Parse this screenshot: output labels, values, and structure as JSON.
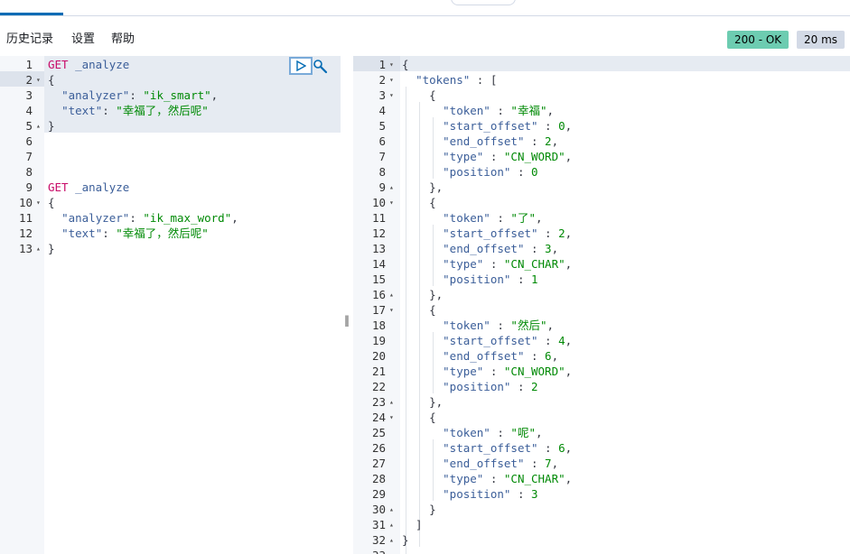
{
  "menu": {
    "history": "历史记录",
    "settings": "设置",
    "help": "帮助"
  },
  "status": {
    "code": "200 - OK",
    "time": "20 ms"
  },
  "request_lines": [
    {
      "n": "1",
      "fold": "",
      "segs": [
        [
          "GET",
          "k-method"
        ],
        [
          " _analyze",
          "k-key"
        ]
      ]
    },
    {
      "n": "2",
      "fold": "▾",
      "segs": [
        [
          "{",
          "k-punc"
        ]
      ]
    },
    {
      "n": "3",
      "fold": "",
      "segs": [
        [
          "  ",
          "k-punc"
        ],
        [
          "\"analyzer\"",
          "k-key"
        ],
        [
          ": ",
          "k-punc"
        ],
        [
          "\"ik_smart\"",
          "k-str"
        ],
        [
          ",",
          "k-punc"
        ]
      ]
    },
    {
      "n": "4",
      "fold": "",
      "segs": [
        [
          "  ",
          "k-punc"
        ],
        [
          "\"text\"",
          "k-key"
        ],
        [
          ": ",
          "k-punc"
        ],
        [
          "\"幸福了，然后呢\"",
          "k-str"
        ]
      ]
    },
    {
      "n": "5",
      "fold": "▴",
      "segs": [
        [
          "}",
          "k-punc"
        ]
      ]
    },
    {
      "n": "6",
      "fold": "",
      "segs": []
    },
    {
      "n": "7",
      "fold": "",
      "segs": []
    },
    {
      "n": "8",
      "fold": "",
      "segs": []
    },
    {
      "n": "9",
      "fold": "",
      "segs": [
        [
          "GET",
          "k-method"
        ],
        [
          " _analyze",
          "k-key"
        ]
      ]
    },
    {
      "n": "10",
      "fold": "▾",
      "segs": [
        [
          "{",
          "k-punc"
        ]
      ]
    },
    {
      "n": "11",
      "fold": "",
      "segs": [
        [
          "  ",
          "k-punc"
        ],
        [
          "\"analyzer\"",
          "k-key"
        ],
        [
          ": ",
          "k-punc"
        ],
        [
          "\"ik_max_word\"",
          "k-str"
        ],
        [
          ",",
          "k-punc"
        ]
      ]
    },
    {
      "n": "12",
      "fold": "",
      "segs": [
        [
          "  ",
          "k-punc"
        ],
        [
          "\"text\"",
          "k-key"
        ],
        [
          ": ",
          "k-punc"
        ],
        [
          "\"幸福了，然后呢\"",
          "k-str"
        ]
      ]
    },
    {
      "n": "13",
      "fold": "▴",
      "segs": [
        [
          "}",
          "k-punc"
        ]
      ]
    }
  ],
  "response_lines": [
    {
      "n": "1",
      "fold": "▾",
      "segs": [
        [
          "{",
          "k-punc"
        ]
      ]
    },
    {
      "n": "2",
      "fold": "▾",
      "segs": [
        [
          "  ",
          "k-punc"
        ],
        [
          "\"tokens\"",
          "k-key"
        ],
        [
          " : [",
          "k-punc"
        ]
      ]
    },
    {
      "n": "3",
      "fold": "▾",
      "segs": [
        [
          "    {",
          "k-punc"
        ]
      ]
    },
    {
      "n": "4",
      "fold": "",
      "segs": [
        [
          "      ",
          "k-punc"
        ],
        [
          "\"token\"",
          "k-key"
        ],
        [
          " : ",
          "k-punc"
        ],
        [
          "\"幸福\"",
          "k-str"
        ],
        [
          ",",
          "k-punc"
        ]
      ]
    },
    {
      "n": "5",
      "fold": "",
      "segs": [
        [
          "      ",
          "k-punc"
        ],
        [
          "\"start_offset\"",
          "k-key"
        ],
        [
          " : ",
          "k-punc"
        ],
        [
          "0",
          "k-num"
        ],
        [
          ",",
          "k-punc"
        ]
      ]
    },
    {
      "n": "6",
      "fold": "",
      "segs": [
        [
          "      ",
          "k-punc"
        ],
        [
          "\"end_offset\"",
          "k-key"
        ],
        [
          " : ",
          "k-punc"
        ],
        [
          "2",
          "k-num"
        ],
        [
          ",",
          "k-punc"
        ]
      ]
    },
    {
      "n": "7",
      "fold": "",
      "segs": [
        [
          "      ",
          "k-punc"
        ],
        [
          "\"type\"",
          "k-key"
        ],
        [
          " : ",
          "k-punc"
        ],
        [
          "\"CN_WORD\"",
          "k-str"
        ],
        [
          ",",
          "k-punc"
        ]
      ]
    },
    {
      "n": "8",
      "fold": "",
      "segs": [
        [
          "      ",
          "k-punc"
        ],
        [
          "\"position\"",
          "k-key"
        ],
        [
          " : ",
          "k-punc"
        ],
        [
          "0",
          "k-num"
        ]
      ]
    },
    {
      "n": "9",
      "fold": "▴",
      "segs": [
        [
          "    },",
          "k-punc"
        ]
      ]
    },
    {
      "n": "10",
      "fold": "▾",
      "segs": [
        [
          "    {",
          "k-punc"
        ]
      ]
    },
    {
      "n": "11",
      "fold": "",
      "segs": [
        [
          "      ",
          "k-punc"
        ],
        [
          "\"token\"",
          "k-key"
        ],
        [
          " : ",
          "k-punc"
        ],
        [
          "\"了\"",
          "k-str"
        ],
        [
          ",",
          "k-punc"
        ]
      ]
    },
    {
      "n": "12",
      "fold": "",
      "segs": [
        [
          "      ",
          "k-punc"
        ],
        [
          "\"start_offset\"",
          "k-key"
        ],
        [
          " : ",
          "k-punc"
        ],
        [
          "2",
          "k-num"
        ],
        [
          ",",
          "k-punc"
        ]
      ]
    },
    {
      "n": "13",
      "fold": "",
      "segs": [
        [
          "      ",
          "k-punc"
        ],
        [
          "\"end_offset\"",
          "k-key"
        ],
        [
          " : ",
          "k-punc"
        ],
        [
          "3",
          "k-num"
        ],
        [
          ",",
          "k-punc"
        ]
      ]
    },
    {
      "n": "14",
      "fold": "",
      "segs": [
        [
          "      ",
          "k-punc"
        ],
        [
          "\"type\"",
          "k-key"
        ],
        [
          " : ",
          "k-punc"
        ],
        [
          "\"CN_CHAR\"",
          "k-str"
        ],
        [
          ",",
          "k-punc"
        ]
      ]
    },
    {
      "n": "15",
      "fold": "",
      "segs": [
        [
          "      ",
          "k-punc"
        ],
        [
          "\"position\"",
          "k-key"
        ],
        [
          " : ",
          "k-punc"
        ],
        [
          "1",
          "k-num"
        ]
      ]
    },
    {
      "n": "16",
      "fold": "▴",
      "segs": [
        [
          "    },",
          "k-punc"
        ]
      ]
    },
    {
      "n": "17",
      "fold": "▾",
      "segs": [
        [
          "    {",
          "k-punc"
        ]
      ]
    },
    {
      "n": "18",
      "fold": "",
      "segs": [
        [
          "      ",
          "k-punc"
        ],
        [
          "\"token\"",
          "k-key"
        ],
        [
          " : ",
          "k-punc"
        ],
        [
          "\"然后\"",
          "k-str"
        ],
        [
          ",",
          "k-punc"
        ]
      ]
    },
    {
      "n": "19",
      "fold": "",
      "segs": [
        [
          "      ",
          "k-punc"
        ],
        [
          "\"start_offset\"",
          "k-key"
        ],
        [
          " : ",
          "k-punc"
        ],
        [
          "4",
          "k-num"
        ],
        [
          ",",
          "k-punc"
        ]
      ]
    },
    {
      "n": "20",
      "fold": "",
      "segs": [
        [
          "      ",
          "k-punc"
        ],
        [
          "\"end_offset\"",
          "k-key"
        ],
        [
          " : ",
          "k-punc"
        ],
        [
          "6",
          "k-num"
        ],
        [
          ",",
          "k-punc"
        ]
      ]
    },
    {
      "n": "21",
      "fold": "",
      "segs": [
        [
          "      ",
          "k-punc"
        ],
        [
          "\"type\"",
          "k-key"
        ],
        [
          " : ",
          "k-punc"
        ],
        [
          "\"CN_WORD\"",
          "k-str"
        ],
        [
          ",",
          "k-punc"
        ]
      ]
    },
    {
      "n": "22",
      "fold": "",
      "segs": [
        [
          "      ",
          "k-punc"
        ],
        [
          "\"position\"",
          "k-key"
        ],
        [
          " : ",
          "k-punc"
        ],
        [
          "2",
          "k-num"
        ]
      ]
    },
    {
      "n": "23",
      "fold": "▴",
      "segs": [
        [
          "    },",
          "k-punc"
        ]
      ]
    },
    {
      "n": "24",
      "fold": "▾",
      "segs": [
        [
          "    {",
          "k-punc"
        ]
      ]
    },
    {
      "n": "25",
      "fold": "",
      "segs": [
        [
          "      ",
          "k-punc"
        ],
        [
          "\"token\"",
          "k-key"
        ],
        [
          " : ",
          "k-punc"
        ],
        [
          "\"呢\"",
          "k-str"
        ],
        [
          ",",
          "k-punc"
        ]
      ]
    },
    {
      "n": "26",
      "fold": "",
      "segs": [
        [
          "      ",
          "k-punc"
        ],
        [
          "\"start_offset\"",
          "k-key"
        ],
        [
          " : ",
          "k-punc"
        ],
        [
          "6",
          "k-num"
        ],
        [
          ",",
          "k-punc"
        ]
      ]
    },
    {
      "n": "27",
      "fold": "",
      "segs": [
        [
          "      ",
          "k-punc"
        ],
        [
          "\"end_offset\"",
          "k-key"
        ],
        [
          " : ",
          "k-punc"
        ],
        [
          "7",
          "k-num"
        ],
        [
          ",",
          "k-punc"
        ]
      ]
    },
    {
      "n": "28",
      "fold": "",
      "segs": [
        [
          "      ",
          "k-punc"
        ],
        [
          "\"type\"",
          "k-key"
        ],
        [
          " : ",
          "k-punc"
        ],
        [
          "\"CN_CHAR\"",
          "k-str"
        ],
        [
          ",",
          "k-punc"
        ]
      ]
    },
    {
      "n": "29",
      "fold": "",
      "segs": [
        [
          "      ",
          "k-punc"
        ],
        [
          "\"position\"",
          "k-key"
        ],
        [
          " : ",
          "k-punc"
        ],
        [
          "3",
          "k-num"
        ]
      ]
    },
    {
      "n": "30",
      "fold": "▴",
      "segs": [
        [
          "    }",
          "k-punc"
        ]
      ]
    },
    {
      "n": "31",
      "fold": "▴",
      "segs": [
        [
          "  ]",
          "k-punc"
        ]
      ]
    },
    {
      "n": "32",
      "fold": "▴",
      "segs": [
        [
          "}",
          "k-punc"
        ]
      ]
    },
    {
      "n": "33",
      "fold": "",
      "segs": []
    }
  ],
  "icons": {
    "run": "play-icon",
    "settings": "wrench-icon"
  },
  "colors": {
    "status_ok": "#6dccb1",
    "status_time": "#d3dae6",
    "method": "#c80a68",
    "key": "#3b5e99",
    "string": "#018a06",
    "active_tab": "#006bb4"
  }
}
